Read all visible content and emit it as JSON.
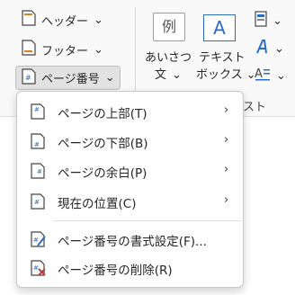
{
  "ribbon": {
    "header_button": {
      "label": "ヘッダー",
      "chevron": "⌄"
    },
    "footer_button": {
      "label": "フッター",
      "chevron": "⌄"
    },
    "page_number_button": {
      "label": "ページ番号",
      "chevron": "⌄"
    },
    "greeting_button": {
      "glyph": "例",
      "line1": "あいさつ",
      "line2": "文",
      "chevron": "⌄"
    },
    "textbox_button": {
      "glyph": "A",
      "line1": "テキスト",
      "line2": "ボックス",
      "chevron": "⌄"
    },
    "group_label_fragment": "スト",
    "small_buttons": [
      {
        "icon": "quick-parts-icon",
        "chevron": "⌄"
      },
      {
        "icon": "wordart-icon",
        "chevron": "⌄"
      },
      {
        "icon": "dropcap-icon",
        "chevron": "⌄"
      }
    ]
  },
  "menu": {
    "items": [
      {
        "label": "ページの上部(T)",
        "icon": "page-number-top-icon",
        "submenu_arrow": "›"
      },
      {
        "label": "ページの下部(B)",
        "icon": "page-number-bottom-icon",
        "submenu_arrow": "›"
      },
      {
        "label": "ページの余白(P)",
        "icon": "page-number-margin-icon",
        "submenu_arrow": "›"
      },
      {
        "label": "現在の位置(C)",
        "icon": "current-position-icon",
        "submenu_arrow": "›"
      },
      {
        "label": "ページ番号の書式設定(F)...",
        "icon": "format-page-numbers-icon"
      },
      {
        "label": "ページ番号の削除(R)",
        "icon": "remove-page-numbers-icon"
      }
    ]
  },
  "colors": {
    "accent_blue": "#2b6cc4",
    "accent_orange": "#e07a1f",
    "delete_red": "#d13438"
  }
}
